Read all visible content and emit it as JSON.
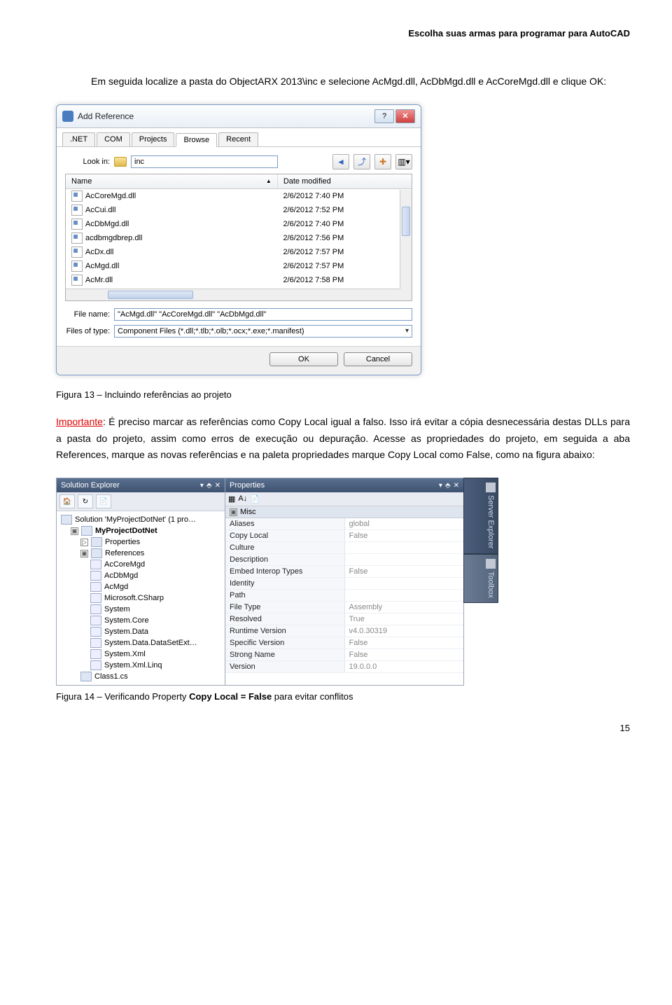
{
  "header": "Escolha suas armas para programar para AutoCAD",
  "intro": "Em seguida localize a pasta do ObjectARX 2013\\inc e selecione AcMgd.dll, AcDbMgd.dll e AcCoreMgd.dll  e clique OK:",
  "dialog": {
    "title": "Add Reference",
    "help": "?",
    "close": "✕",
    "tabs": [
      ".NET",
      "COM",
      "Projects",
      "Browse",
      "Recent"
    ],
    "lookin_label": "Look in:",
    "lookin_value": "inc",
    "col_name": "Name",
    "col_date": "Date modified",
    "files": [
      {
        "name": "AcCoreMgd.dll",
        "date": "2/6/2012 7:40 PM"
      },
      {
        "name": "AcCui.dll",
        "date": "2/6/2012 7:52 PM"
      },
      {
        "name": "AcDbMgd.dll",
        "date": "2/6/2012 7:40 PM"
      },
      {
        "name": "acdbmgdbrep.dll",
        "date": "2/6/2012 7:56 PM"
      },
      {
        "name": "AcDx.dll",
        "date": "2/6/2012 7:57 PM"
      },
      {
        "name": "AcMgd.dll",
        "date": "2/6/2012 7:57 PM"
      },
      {
        "name": "AcMr.dll",
        "date": "2/6/2012 7:58 PM"
      }
    ],
    "filename_label": "File name:",
    "filename_value": "\"AcMgd.dll\" \"AcCoreMgd.dll\" \"AcDbMgd.dll\"",
    "filetype_label": "Files of type:",
    "filetype_value": "Component Files (*.dll;*.tlb;*.olb;*.ocx;*.exe;*.manifest)",
    "ok": "OK",
    "cancel": "Cancel"
  },
  "caption1": "Figura 13 – Incluindo referências ao projeto",
  "importante_label": "Importante",
  "paragraph2_part1": ": É preciso marcar as referências como Copy Local igual a falso. Isso irá evitar a cópia desnecessária destas DLLs para a pasta do projeto, assim como erros de execução ou depuração. Acesse as propriedades do projeto, em seguida a aba References, marque as novas referências e na paleta propriedades marque Copy Local como False, como na figura abaixo:",
  "vs": {
    "solution_title": "Solution Explorer",
    "pin": "▾ ⬘ ✕",
    "solution_root": "Solution 'MyProjectDotNet' (1 pro…",
    "project": "MyProjectDotNet",
    "nodes": [
      "Properties",
      "References",
      "AcCoreMgd",
      "AcDbMgd",
      "AcMgd",
      "Microsoft.CSharp",
      "System",
      "System.Core",
      "System.Data",
      "System.Data.DataSetExt…",
      "System.Xml",
      "System.Xml.Linq",
      "Class1.cs"
    ],
    "props_title": "Properties",
    "section": "Misc",
    "props": [
      {
        "n": "Aliases",
        "v": "global"
      },
      {
        "n": "Copy Local",
        "v": "False"
      },
      {
        "n": "Culture",
        "v": ""
      },
      {
        "n": "Description",
        "v": ""
      },
      {
        "n": "Embed Interop Types",
        "v": "False"
      },
      {
        "n": "Identity",
        "v": ""
      },
      {
        "n": "Path",
        "v": ""
      },
      {
        "n": "File Type",
        "v": "Assembly"
      },
      {
        "n": "Resolved",
        "v": "True"
      },
      {
        "n": "Runtime Version",
        "v": "v4.0.30319"
      },
      {
        "n": "Specific Version",
        "v": "False"
      },
      {
        "n": "Strong Name",
        "v": "False"
      },
      {
        "n": "Version",
        "v": "19.0.0.0"
      }
    ],
    "side1": "Server Explorer",
    "side2": "Toolbox"
  },
  "caption2_prefix": "Figura 14 – Verificando Property ",
  "caption2_bold": "Copy Local = False",
  "caption2_suffix": " para evitar conflitos",
  "pagenum": "15"
}
